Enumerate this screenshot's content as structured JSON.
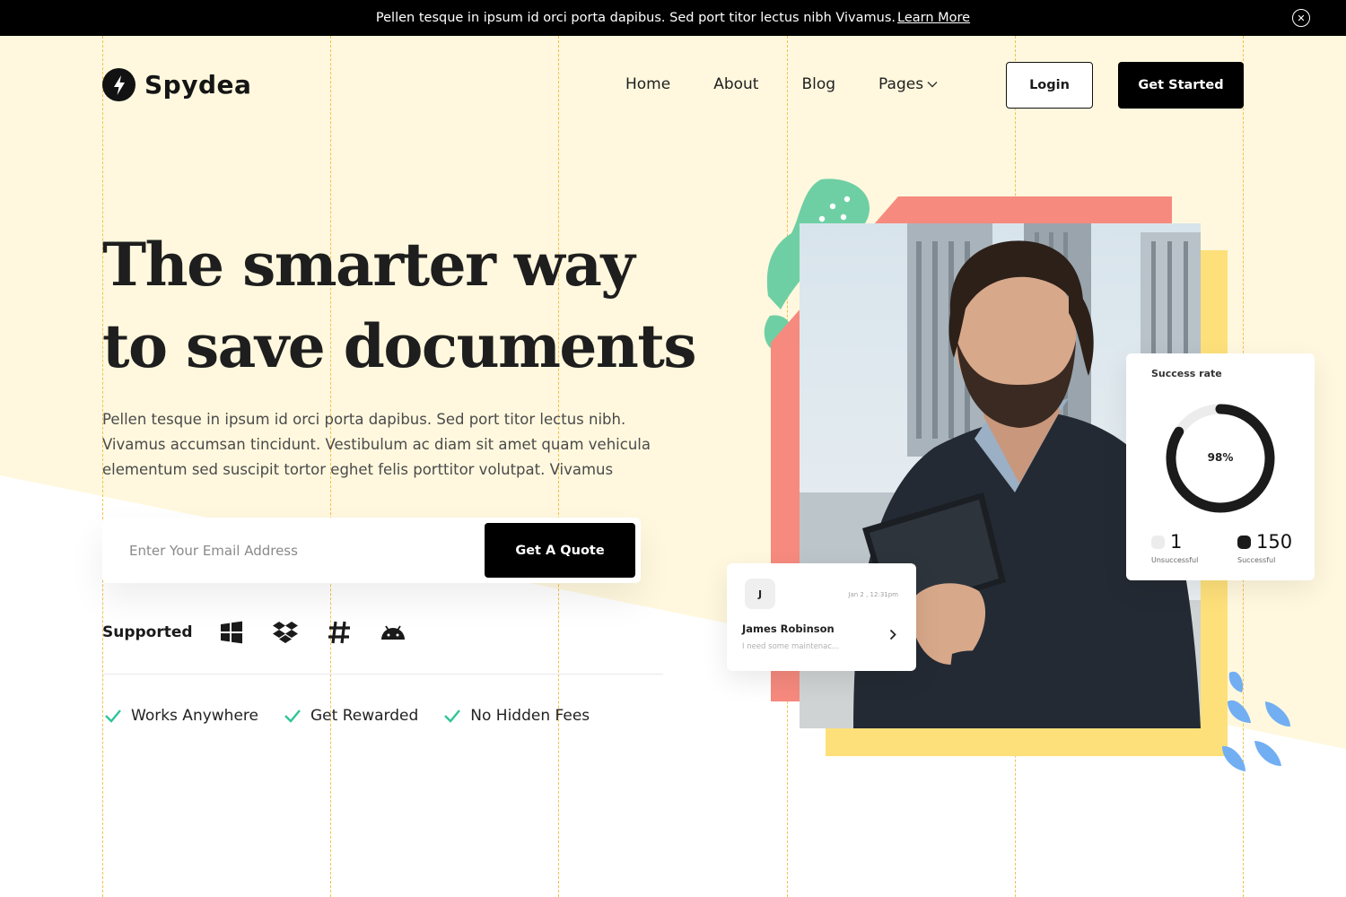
{
  "announcement": {
    "text": "Pellen tesque in ipsum id orci porta dapibus. Sed port titor lectus nibh Vivamus.",
    "link": "Learn More",
    "close_icon": "close-circle-icon"
  },
  "brand": {
    "name": "Spydea",
    "icon": "lightning-bolt-icon"
  },
  "nav": {
    "items": [
      "Home",
      "About",
      "Blog",
      "Pages"
    ],
    "dropdown_icon": "chevron-down-icon"
  },
  "header_actions": {
    "login": "Login",
    "get_started": "Get Started"
  },
  "hero": {
    "title_line1": "The smarter way",
    "title_line2": "to save documents",
    "description": "Pellen tesque in ipsum id orci porta dapibus. Sed port titor lectus nibh. Vivamus accumsan tincidunt. Vestibulum ac diam sit amet quam vehicula elementum sed suscipit tortor eghet felis porttitor volutpat. Vivamus",
    "email_placeholder": "Enter Your Email Address",
    "cta": "Get A Quote"
  },
  "supported": {
    "label": "Supported",
    "icons": [
      "windows-icon",
      "dropbox-icon",
      "hashtag-icon",
      "android-icon"
    ]
  },
  "features": [
    "Works Anywhere",
    "Get Rewarded",
    "No Hidden Fees"
  ],
  "success_card": {
    "title": "Success rate",
    "percent_label": "98%",
    "percent": 0.98,
    "unsuccessful": {
      "value": "1",
      "label": "Unsuccessful"
    },
    "successful": {
      "value": "150",
      "label": "Successful"
    }
  },
  "message_card": {
    "initial": "J",
    "date": "Jan 2 , 12:31pm",
    "name": "James Robinson",
    "preview": "I need some maintenac..."
  },
  "colors": {
    "cream": "#fff8de",
    "coral": "#f68a7e",
    "mint": "#6fcfa4",
    "yellow": "#fde07a",
    "blue": "#72aef2",
    "check": "#2fc49a",
    "dark": "#000000"
  }
}
